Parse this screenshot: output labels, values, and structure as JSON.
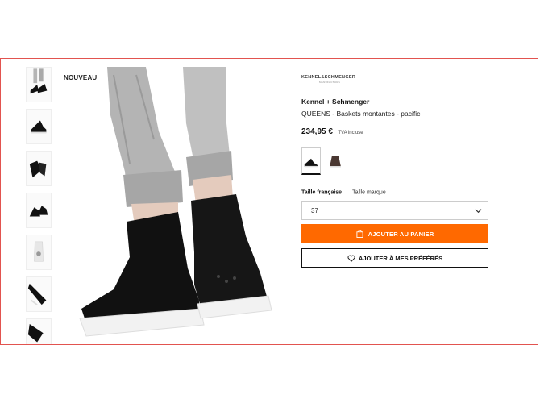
{
  "badge": "NOUVEAU",
  "brand": {
    "logo_text": "KENNEL&SCHMENGER",
    "logo_subtext": "MANUFACTURE",
    "name": "Kennel + Schmenger"
  },
  "product": {
    "name": "QUEENS - Baskets montantes - pacific",
    "price": "234,95 €",
    "tax_note": "TVA incluse"
  },
  "size": {
    "tab_active": "Taille française",
    "tab_other": "Taille marque",
    "selected": "37"
  },
  "buttons": {
    "add_to_cart": "AJOUTER AU PANIER",
    "add_to_favorites": "AJOUTER À MES PRÉFÉRÉS"
  },
  "colors": {
    "accent": "#ff6900",
    "border": "#e2534f"
  },
  "swatches": [
    {
      "color": "#111111",
      "selected": true
    },
    {
      "color": "#4a3832",
      "selected": false
    }
  ]
}
